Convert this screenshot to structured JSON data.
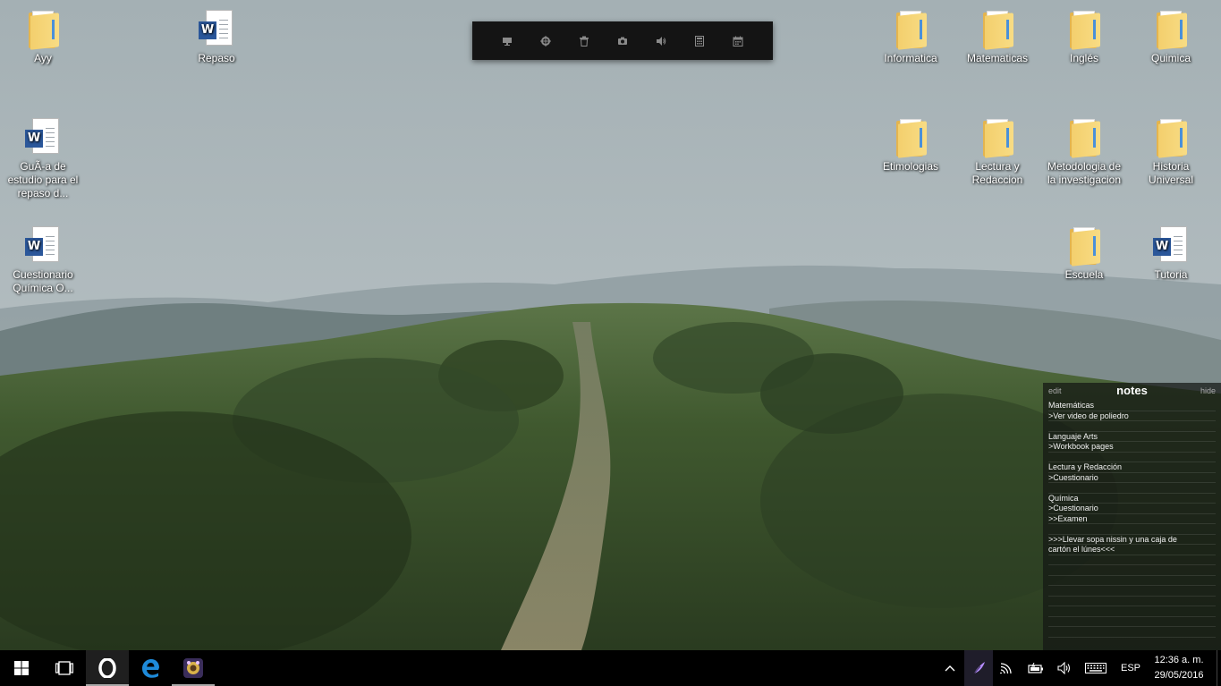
{
  "desktop_icons_left": [
    {
      "label": "Ayy",
      "type": "folder"
    },
    {
      "label": "Repaso",
      "type": "word"
    },
    {
      "label": "GuÃ-a de estudio para el repaso d...",
      "type": "word"
    },
    {
      "label": "Cuestionario Química O...",
      "type": "word"
    }
  ],
  "desktop_icons_right": [
    {
      "label": "Informatica",
      "type": "folder"
    },
    {
      "label": "Matematicas",
      "type": "folder"
    },
    {
      "label": "Inglés",
      "type": "folder"
    },
    {
      "label": "Quimica",
      "type": "folder"
    },
    {
      "label": "Etimologias",
      "type": "folder"
    },
    {
      "label": "Lectura y Redaccion",
      "type": "folder"
    },
    {
      "label": "Metodologia de la investigacion",
      "type": "folder"
    },
    {
      "label": "Historia Universal",
      "type": "folder"
    },
    {
      "label": "Escuela",
      "type": "folder"
    },
    {
      "label": "Tutoria",
      "type": "word"
    }
  ],
  "top_toolbar": {
    "buttons": [
      "monitor-icon",
      "crosshair-icon",
      "trash-icon",
      "camera-icon",
      "volume-icon",
      "calculator-icon",
      "calendar-icon"
    ]
  },
  "notes": {
    "edit": "edit",
    "title": "notes",
    "hide": "hide",
    "lines": [
      "Matemáticas",
      ">Ver video de poliedro",
      "",
      "Languaje Arts",
      ">Workbook pages",
      "",
      "Lectura y Redacción",
      ">Cuestionario",
      "",
      "Química",
      ">Cuestionario",
      ">>Examen",
      "",
      ">>>Llevar sopa nissin y una caja de",
      "cartón el lúnes<<<",
      "",
      "",
      "",
      "",
      "",
      "",
      "",
      "",
      ""
    ]
  },
  "taskbar": {
    "apps": [
      "start-icon",
      "task-view-icon",
      "opera-icon",
      "edge-icon",
      "app-icon"
    ],
    "language": "ESP",
    "time": "12:36 a. m.",
    "date": "29/05/2016"
  }
}
